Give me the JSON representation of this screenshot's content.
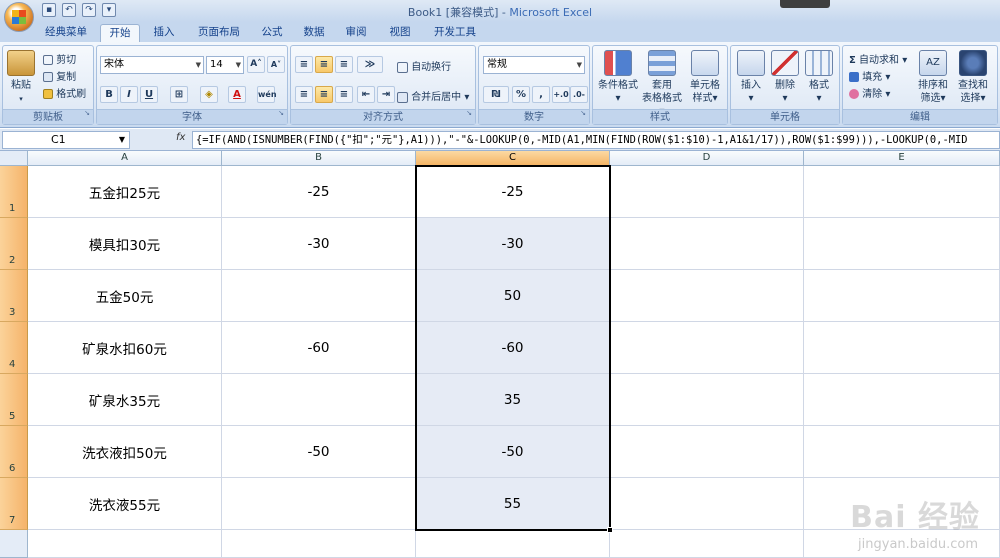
{
  "window": {
    "title_file": "Book1",
    "title_mode": "[兼容模式]",
    "title_sep": " - ",
    "title_app": "Microsoft Excel"
  },
  "ribbon_tabs": [
    "经典菜单",
    "开始",
    "插入",
    "页面布局",
    "公式",
    "数据",
    "审阅",
    "视图",
    "开发工具"
  ],
  "active_tab": "开始",
  "clipboard": {
    "paste": "粘贴",
    "cut": "剪切",
    "copy": "复制",
    "format_painter": "格式刷",
    "label": "剪贴板"
  },
  "font": {
    "name": "宋体",
    "size": "14",
    "label": "字体",
    "bold": "B",
    "italic": "I",
    "underline": "U"
  },
  "alignment": {
    "wrap": "自动换行",
    "merge": "合并后居中",
    "label": "对齐方式"
  },
  "number": {
    "format": "常规",
    "label": "数字",
    "percent": "%",
    "comma": ","
  },
  "styles": {
    "conditional": "条件格式",
    "table1": "套用",
    "table2": "表格格式",
    "cell1": "单元格",
    "cell2": "样式",
    "label": "样式"
  },
  "cells": {
    "insert": "插入",
    "delete": "删除",
    "format": "格式",
    "label": "单元格"
  },
  "editing": {
    "autosum": "自动求和",
    "fill": "填充",
    "clear": "清除",
    "sort1": "排序和",
    "sort2": "筛选",
    "find1": "查找和",
    "find2": "选择",
    "label": "编辑"
  },
  "formula_bar": {
    "name_box": "C1",
    "fx": "fx",
    "formula": "{=IF(AND(ISNUMBER(FIND({\"扣\";\"元\"},A1))),\"-\"&-LOOKUP(0,-MID(A1,MIN(FIND(ROW($1:$10)-1,A1&1/17)),ROW($1:$99))),-LOOKUP(0,-MID"
  },
  "columns": [
    "A",
    "B",
    "C",
    "D",
    "E"
  ],
  "rows": [
    {
      "num": "1",
      "a": "五金扣25元",
      "b": "-25",
      "c": "-25"
    },
    {
      "num": "2",
      "a": "模具扣30元",
      "b": "-30",
      "c": "-30"
    },
    {
      "num": "3",
      "a": "五金50元",
      "b": "",
      "c": "50"
    },
    {
      "num": "4",
      "a": "矿泉水扣60元",
      "b": "-60",
      "c": "-60"
    },
    {
      "num": "5",
      "a": "矿泉水35元",
      "b": "",
      "c": "35"
    },
    {
      "num": "6",
      "a": "洗衣液扣50元",
      "b": "-50",
      "c": "-50"
    },
    {
      "num": "7",
      "a": "洗衣液55元",
      "b": "",
      "c": "55"
    }
  ],
  "watermark": {
    "brand": "Bai 经验",
    "url": "jingyan.baidu.com"
  }
}
